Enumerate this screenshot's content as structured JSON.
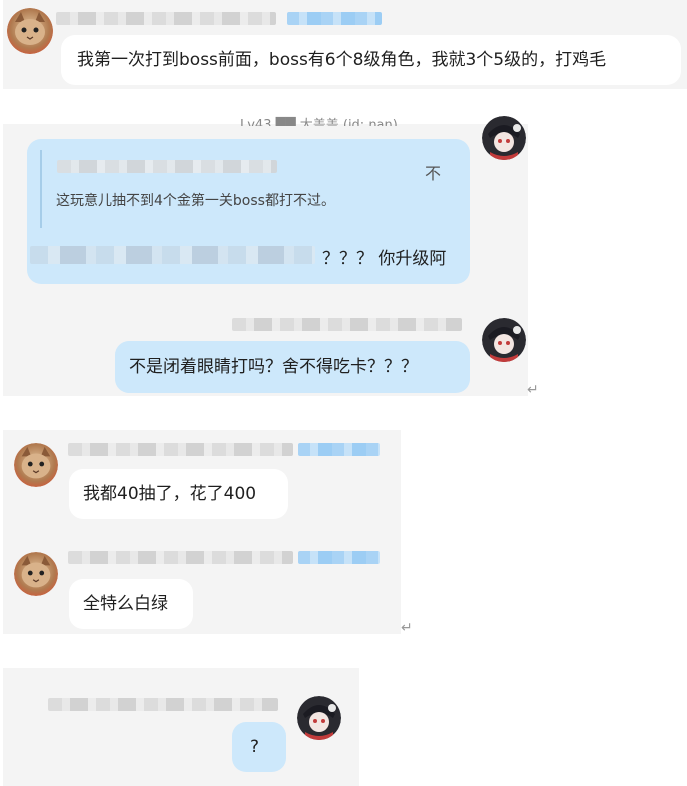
{
  "messages": {
    "m1": {
      "text": "我第一次打到boss前面，boss有6个8级角色，我就3个5级的，打鸡毛"
    },
    "m2": {
      "header_partial": "Lv43 ██ 大盖盖 (id: nan)",
      "quote_text": "这玩意儿抽不到4个金第一关boss都打不过。",
      "quote_mark": "不",
      "reply_text": "？？？ 你升级阿"
    },
    "m3": {
      "text": "不是闭着眼睛打吗？舍不得吃卡？？？"
    },
    "m4": {
      "text": "我都40抽了，花了400"
    },
    "m5": {
      "text": "全特么白绿"
    },
    "m6": {
      "text": "?"
    }
  },
  "icons": {
    "return": "↵",
    "cat_avatar": "cat-avatar",
    "anime_avatar": "anime-avatar"
  },
  "colors": {
    "panel_bg": "#f4f4f4",
    "bubble_blue": "#cde8fb",
    "bubble_white": "#ffffff"
  }
}
